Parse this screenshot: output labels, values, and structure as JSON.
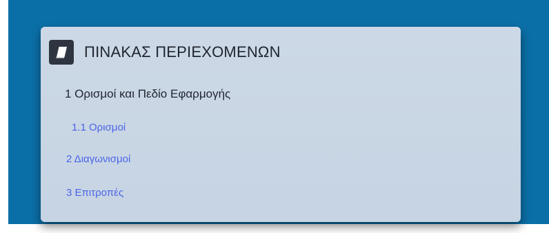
{
  "toc": {
    "icon": "book-icon",
    "title": "ΠΙΝΑΚΑΣ ΠΕΡΙΕΧΟΜΕΝΩΝ",
    "items": [
      {
        "label": "1 Ορισμοί και Πεδίο Εφαρμογής"
      },
      {
        "label": "1.1 Ορισμοί"
      },
      {
        "label": "2 Διαγωνισμοί"
      },
      {
        "label": "3 Επιτροπές"
      }
    ]
  },
  "colors": {
    "background": "#0b6fa7",
    "panel": "#c9d6e4",
    "heading_text": "#1f2530",
    "link_text": "#4a64e8",
    "icon_bg": "#2e3540"
  }
}
